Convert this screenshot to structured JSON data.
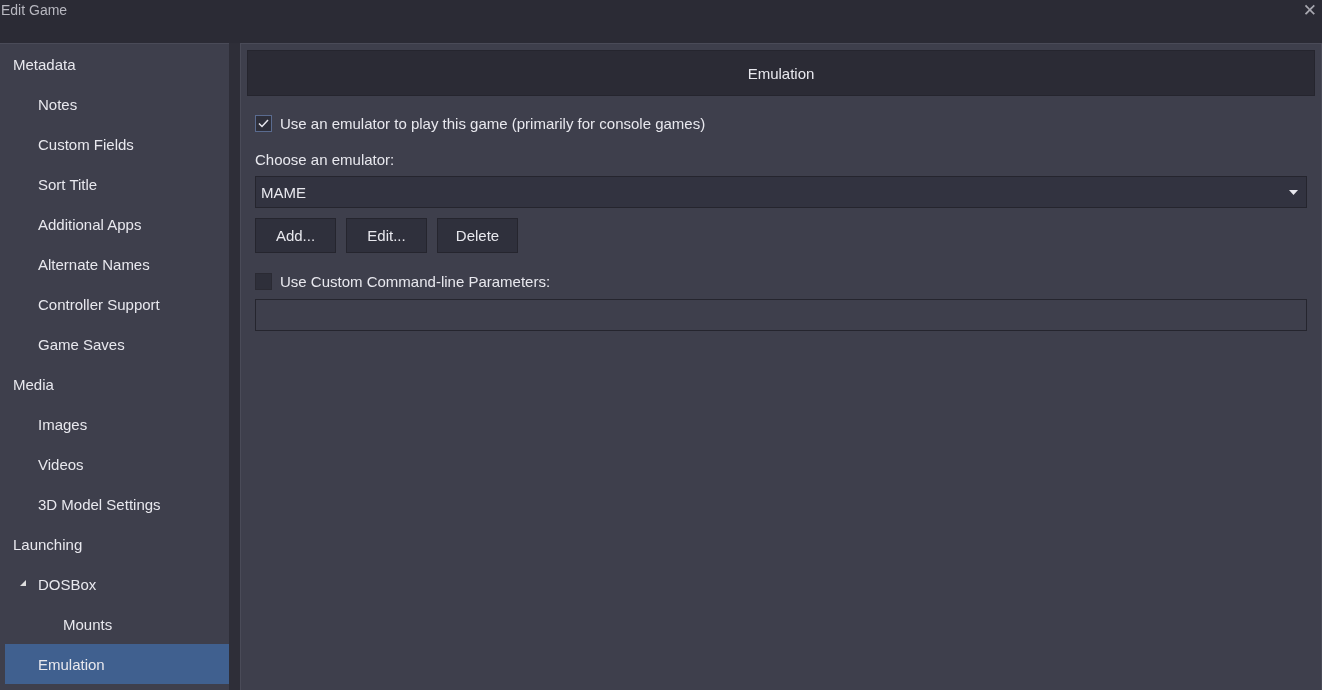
{
  "window": {
    "title": "Edit Game",
    "close_glyph": "✕"
  },
  "sidebar": {
    "items": [
      {
        "label": "Metadata",
        "selected": false,
        "children": [
          {
            "label": "Notes",
            "selected": false
          },
          {
            "label": "Custom Fields",
            "selected": false
          },
          {
            "label": "Sort Title",
            "selected": false
          },
          {
            "label": "Additional Apps",
            "selected": false
          },
          {
            "label": "Alternate Names",
            "selected": false
          },
          {
            "label": "Controller Support",
            "selected": false
          },
          {
            "label": "Game Saves",
            "selected": false
          }
        ]
      },
      {
        "label": "Media",
        "selected": false,
        "children": [
          {
            "label": "Images",
            "selected": false
          },
          {
            "label": "Videos",
            "selected": false
          },
          {
            "label": "3D Model Settings",
            "selected": false
          }
        ]
      },
      {
        "label": "Launching",
        "selected": false,
        "children": [
          {
            "label": "DOSBox",
            "selected": false,
            "expanded": true,
            "children": [
              {
                "label": "Mounts",
                "selected": false
              }
            ]
          },
          {
            "label": "Emulation",
            "selected": true
          }
        ]
      }
    ]
  },
  "panel": {
    "title": "Emulation",
    "use_emulator": {
      "label": "Use an emulator to play this game (primarily for console games)",
      "checked": true
    },
    "emulator_label": "Choose an emulator:",
    "emulator": {
      "value": "MAME"
    },
    "buttons": [
      "Add...",
      "Edit...",
      "Delete"
    ],
    "custom_params": {
      "label": "Use Custom Command-line Parameters:",
      "checked": false
    }
  }
}
